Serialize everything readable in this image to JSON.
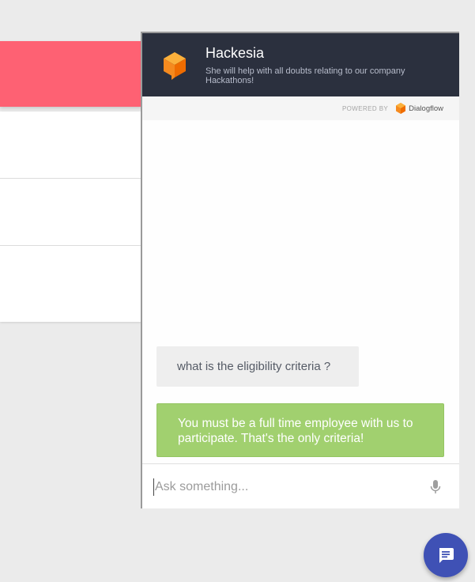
{
  "chat": {
    "bot_name": "Hackesia",
    "bot_description": "She will help with all doubts relating to our company Hackathons!",
    "powered_by_label": "POWERED BY",
    "powered_by_brand": "Dialogflow",
    "messages": [
      {
        "from": "user",
        "text": "what is the eligibility criteria ?"
      },
      {
        "from": "bot",
        "text": "You must be a full time employee with us to participate. That's the only criteria!"
      }
    ],
    "input_placeholder": "Ask something...",
    "input_value": ""
  },
  "icons": {
    "bot_avatar": "orange-cube-icon",
    "dialogflow_logo": "dialogflow-logo-icon",
    "microphone": "microphone-icon",
    "chat_fab": "chat-message-icon"
  },
  "colors": {
    "header_bg": "#2b303e",
    "banner_bg": "#fe6173",
    "bot_bubble": "#a1d06f",
    "user_bubble": "#eeeeee",
    "fab_bg": "#3f51b5",
    "accent_orange": "#f58a1f"
  }
}
